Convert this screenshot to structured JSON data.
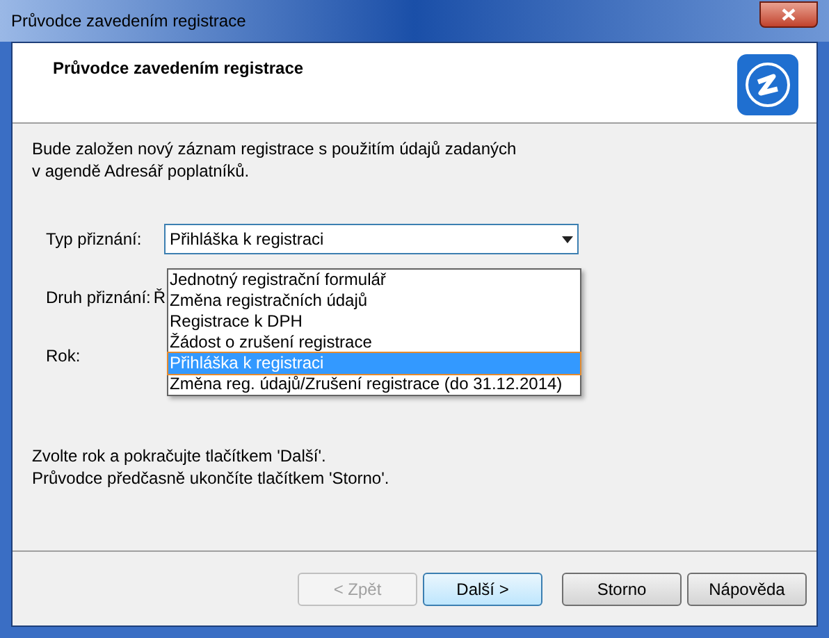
{
  "window": {
    "title": "Průvodce zavedením registrace"
  },
  "header": {
    "title": "Průvodce zavedením registrace"
  },
  "intro": "Bude založen nový záznam registrace s použitím údajů zadaných\nv agendě Adresář poplatníků.",
  "fields": [
    {
      "label": "Typ přiznání:",
      "value": "Přihláška k registraci",
      "kind": "combo"
    },
    {
      "label": "Druh přiznání:",
      "value": "Ř",
      "kind": "text"
    },
    {
      "label": "Rok:",
      "kind": "empty"
    }
  ],
  "dropdown": {
    "items": [
      {
        "label": "Jednotný registrační formulář",
        "selected": false
      },
      {
        "label": "Změna registračních údajů",
        "selected": false
      },
      {
        "label": "Registrace k DPH",
        "selected": false
      },
      {
        "label": "Žádost o zrušení registrace",
        "selected": false
      },
      {
        "label": "Přihláška k registraci",
        "selected": true
      },
      {
        "label": "Změna reg. údajů/Zrušení registrace (do 31.12.2014)",
        "selected": false
      }
    ]
  },
  "hint": "Zvolte rok a pokračujte tlačítkem 'Další'.\nPrůvodce předčasně ukončíte tlačítkem 'Storno'.",
  "buttons": [
    {
      "label": "< Zpět",
      "disabled": true,
      "default": false
    },
    {
      "label": "Další >",
      "disabled": false,
      "default": true
    },
    {
      "label": "Storno",
      "disabled": false,
      "default": false
    },
    {
      "label": "Nápověda",
      "disabled": false,
      "default": false
    }
  ]
}
